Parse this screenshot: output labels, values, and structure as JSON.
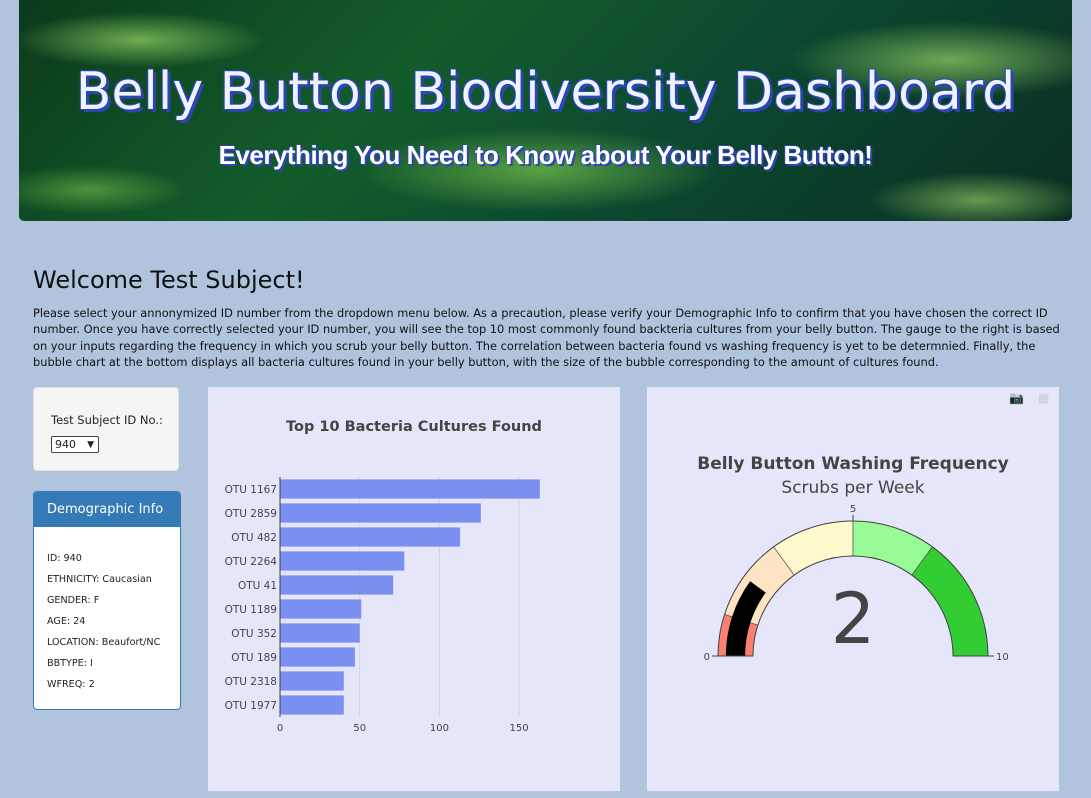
{
  "banner": {
    "title": "Belly Button Biodiversity Dashboard",
    "subtitle": "Everything You Need to Know about Your Belly Button!"
  },
  "welcome": {
    "heading": "Welcome Test Subject!",
    "intro": "Please select your annonymized ID number from the dropdown menu below. As a precaution, please verify your Demographic Info to confirm that you have chosen the correct ID number. Once you have correctly selected your ID number, you will see the top 10 most commonly found backteria cultures from your belly button. The gauge to the right is based on your inputs regarding the frequency in which you scrub your belly button. The correlation between bacteria found vs washing frequency is yet to be determnied. Finally, the bubble chart at the bottom displays all bacteria cultures found in your belly button, with the size of the bubble corresponding to the amount of cultures found."
  },
  "selector": {
    "label": "Test Subject ID No.:",
    "selected": "940",
    "caret_icon": "chevron-down-icon"
  },
  "demographics": {
    "heading": "Demographic Info",
    "rows": [
      "ID: 940",
      "ETHNICITY: Caucasian",
      "GENDER: F",
      "AGE: 24",
      "LOCATION: Beaufort/NC",
      "BBTYPE: I",
      "WFREQ: 2"
    ]
  },
  "colors": {
    "background": "#b0c4de",
    "card": "#e6e6fa",
    "panel_primary": "#337ab7",
    "bar": "#7b8ff0"
  },
  "chart_data": [
    {
      "type": "bar",
      "orientation": "horizontal",
      "title": "Top 10 Bacteria Cultures Found",
      "categories": [
        "OTU 1167",
        "OTU 2859",
        "OTU 482",
        "OTU 2264",
        "OTU 41",
        "OTU 1189",
        "OTU 352",
        "OTU 189",
        "OTU 2318",
        "OTU 1977"
      ],
      "values": [
        163,
        126,
        113,
        78,
        71,
        51,
        50,
        47,
        40,
        40
      ],
      "xlim": [
        0,
        165
      ],
      "xticks": [
        "0",
        "50",
        "100",
        "150"
      ],
      "grid": true
    },
    {
      "type": "gauge",
      "title": "Belly Button Washing Frequency",
      "subtitle": "Scrubs per Week",
      "value": 2,
      "value_label": "2",
      "range": [
        0,
        10
      ],
      "tick_labels": [
        "0",
        "5",
        "10"
      ],
      "steps": [
        {
          "range": [
            0,
            1
          ],
          "color": "#fa8072"
        },
        {
          "range": [
            1,
            3
          ],
          "color": "#ffe4c4"
        },
        {
          "range": [
            3,
            5
          ],
          "color": "#fffacd"
        },
        {
          "range": [
            5,
            7
          ],
          "color": "#98fb98"
        },
        {
          "range": [
            7,
            10
          ],
          "color": "#32cd32"
        }
      ],
      "bar_color": "#000000"
    }
  ]
}
